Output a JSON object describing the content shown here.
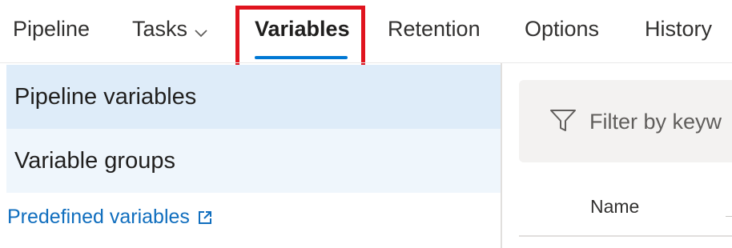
{
  "tabs": [
    {
      "label": "Pipeline"
    },
    {
      "label": "Tasks"
    },
    {
      "label": "Variables"
    },
    {
      "label": "Retention"
    },
    {
      "label": "Options"
    },
    {
      "label": "History"
    }
  ],
  "active_tab": "Variables",
  "sidebar": {
    "items": [
      {
        "label": "Pipeline variables",
        "selected": true
      },
      {
        "label": "Variable groups",
        "selected": false
      }
    ],
    "link": {
      "label": "Predefined variables",
      "icon": "external-link-icon"
    }
  },
  "filter": {
    "placeholder": "Filter by keyw",
    "icon": "filter-icon"
  },
  "table": {
    "columns": [
      "Name"
    ]
  },
  "colors": {
    "accent": "#0078d4",
    "highlight": "#e0141e",
    "selected_bg": "#deecf9",
    "link": "#106ebe"
  }
}
